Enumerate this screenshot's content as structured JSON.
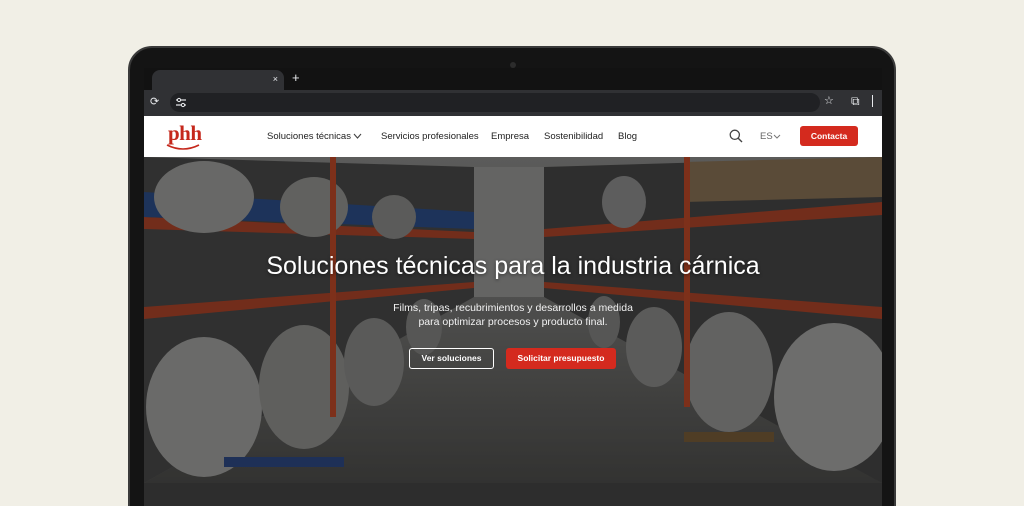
{
  "browser": {
    "tab_close": "×",
    "new_tab": "+",
    "reload": "⟳",
    "star": "☆",
    "extensions": "⧉"
  },
  "nav": {
    "logo": "phh",
    "items": [
      "Soluciones técnicas",
      "Servicios profesionales",
      "Empresa",
      "Sostenibilidad",
      "Blog"
    ],
    "lang": "ES",
    "contact": "Contacta"
  },
  "hero": {
    "title": "Soluciones técnicas para la industria cárnica",
    "subtitle_line1": "Films, tripas, recubrimientos y desarrollos a medida",
    "subtitle_line2": "para optimizar procesos y producto final.",
    "btn_solutions": "Ver soluciones",
    "btn_quote": "Solicitar presupuesto"
  },
  "colors": {
    "brand_red": "#d42a1e",
    "background": "#f1efe6",
    "bezel": "#141414"
  },
  "icons": {
    "search": "search-icon",
    "chevron": "chevron-down-icon",
    "reload": "reload-icon",
    "star": "bookmark-star-icon",
    "extensions": "extensions-icon"
  }
}
